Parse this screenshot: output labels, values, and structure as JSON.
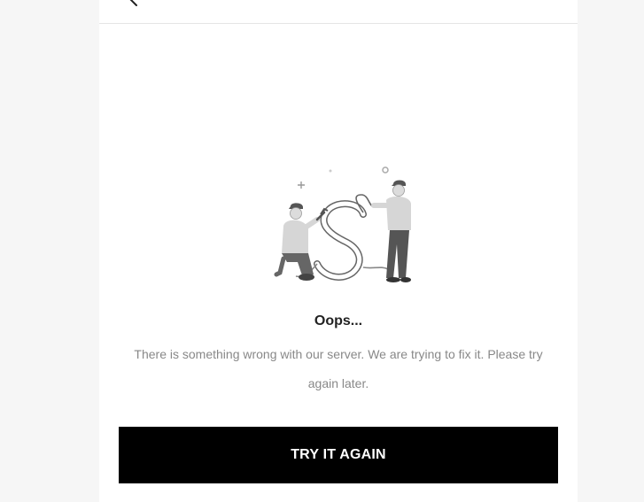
{
  "error": {
    "title": "Oops...",
    "message": "There is something wrong with our server. We are trying to fix it. Please try again later.",
    "retry_label": "TRY IT AGAIN"
  },
  "icons": {
    "back": "chevron-left-icon",
    "illustration": "server-repair-illustration"
  },
  "colors": {
    "button_background": "#000000",
    "button_text": "#ffffff",
    "page_background": "#f6f6f6",
    "panel_background": "#ffffff"
  }
}
